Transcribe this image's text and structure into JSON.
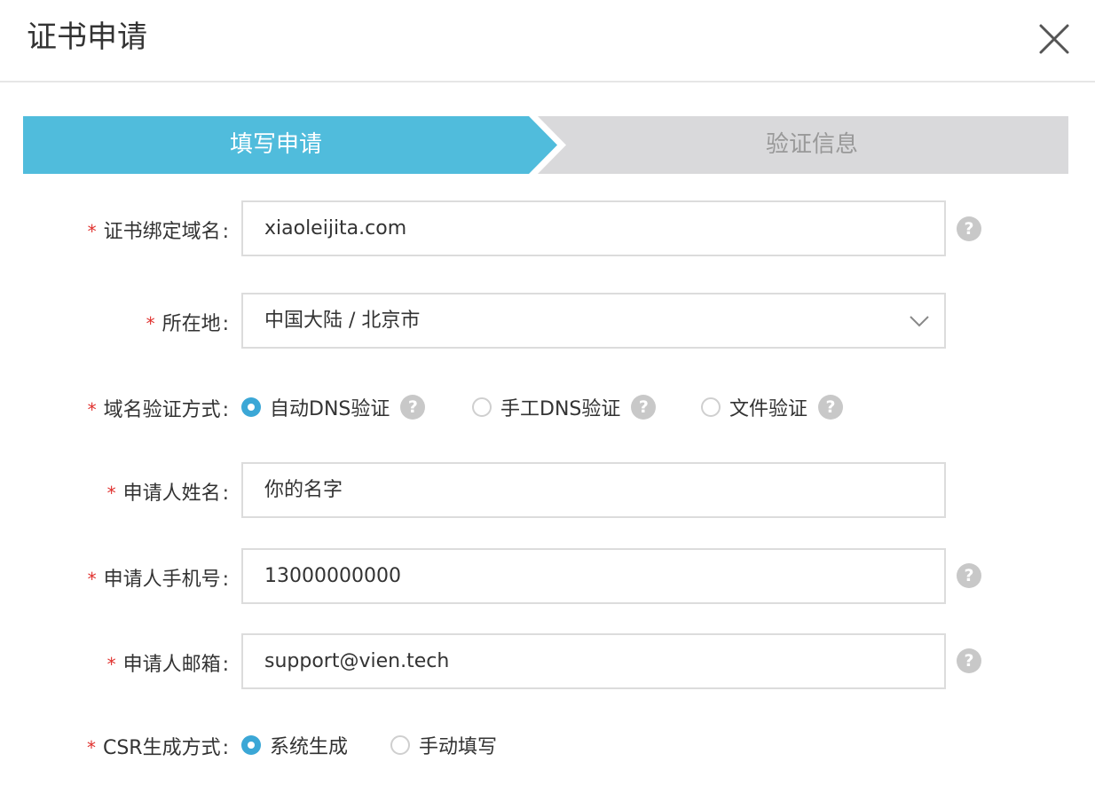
{
  "dialog": {
    "title": "证书申请"
  },
  "steps": [
    {
      "label": "填写申请",
      "active": true
    },
    {
      "label": "验证信息",
      "active": false
    }
  ],
  "colors": {
    "active_step": "#50bcdc",
    "inactive_step": "#d9d9db",
    "radio_selected": "#3ba7d6",
    "required_star": "#e0322f"
  },
  "form": {
    "domain": {
      "label": "证书绑定域名",
      "value": "xiaoleijita.com",
      "help": "?"
    },
    "location": {
      "label": "所在地",
      "value": "中国大陆 / 北京市"
    },
    "verify_method": {
      "label": "域名验证方式",
      "options": [
        {
          "label": "自动DNS验证",
          "selected": true,
          "help": "?"
        },
        {
          "label": "手工DNS验证",
          "selected": false,
          "help": "?"
        },
        {
          "label": "文件验证",
          "selected": false,
          "help": "?"
        }
      ]
    },
    "name": {
      "label": "申请人姓名",
      "value": "你的名字"
    },
    "phone": {
      "label": "申请人手机号",
      "value": "13000000000",
      "help": "?"
    },
    "email": {
      "label": "申请人邮箱",
      "value": "support@vien.tech",
      "help": "?"
    },
    "csr": {
      "label": "CSR生成方式",
      "options": [
        {
          "label": "系统生成",
          "selected": true
        },
        {
          "label": "手动填写",
          "selected": false
        }
      ]
    },
    "required_mark": "*",
    "colon": ":"
  }
}
